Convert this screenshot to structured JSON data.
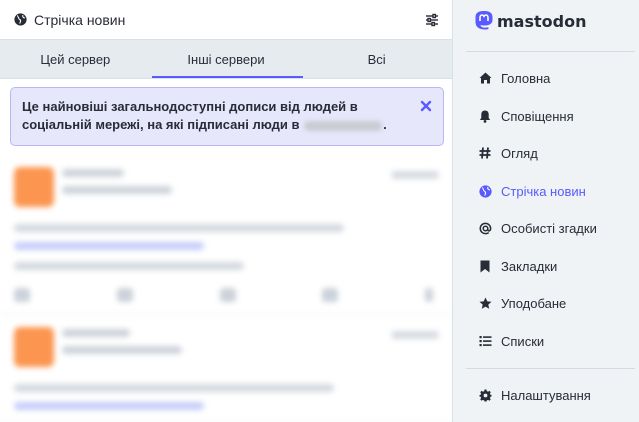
{
  "column": {
    "title": "Стрічка новин",
    "header_icon": "globe-icon",
    "settings_icon": "sliders-icon"
  },
  "tabs": [
    {
      "label": "Цей сервер",
      "active": false
    },
    {
      "label": "Інші сервери",
      "active": true
    },
    {
      "label": "Всі",
      "active": false
    }
  ],
  "notice": {
    "text": "Це найновіші загальнодоступні дописи від людей в соціальній мережі, на які підписані люди в",
    "text_end": ".",
    "close_icon": "close-icon"
  },
  "nav": {
    "logo_text": "mastodon",
    "items": [
      {
        "label": "Головна",
        "icon": "home-icon",
        "active": false
      },
      {
        "label": "Сповіщення",
        "icon": "bell-icon",
        "active": false
      },
      {
        "label": "Огляд",
        "icon": "hashtag-icon",
        "active": false
      },
      {
        "label": "Стрічка новин",
        "icon": "globe-icon",
        "active": true
      },
      {
        "label": "Особисті згадки",
        "icon": "at-icon",
        "active": false
      },
      {
        "label": "Закладки",
        "icon": "bookmark-icon",
        "active": false
      },
      {
        "label": "Уподобане",
        "icon": "star-icon",
        "active": false
      },
      {
        "label": "Списки",
        "icon": "list-icon",
        "active": false
      },
      {
        "label": "Налаштування",
        "icon": "gear-icon",
        "active": false
      }
    ]
  },
  "colors": {
    "accent": "#595aff",
    "notice_bg": "#e6e7fb",
    "avatar": "#fb8a3c"
  }
}
